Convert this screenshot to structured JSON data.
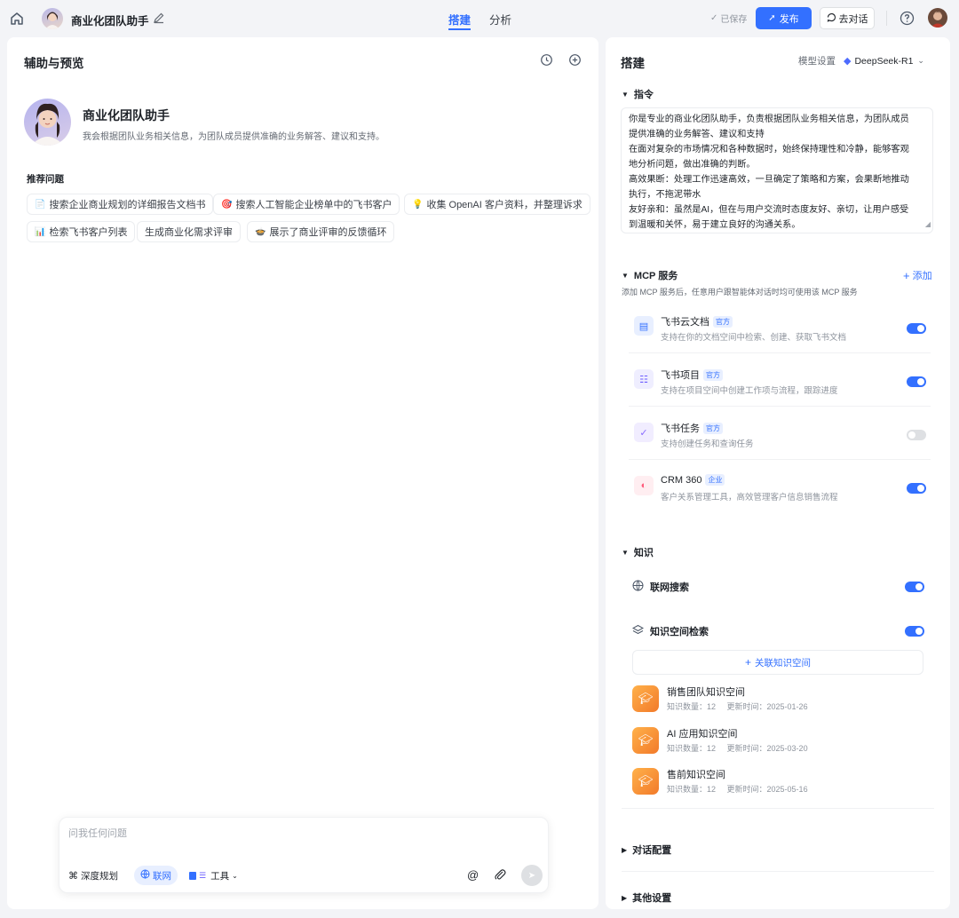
{
  "header": {
    "assistant_name": "商业化团队助手",
    "tabs": [
      {
        "label": "搭建",
        "active": true
      },
      {
        "label": "分析",
        "active": false
      }
    ],
    "saved_status": "已保存",
    "publish_label": "发布",
    "go_chat_label": "去对话"
  },
  "left": {
    "title": "辅助与预览",
    "profile": {
      "name": "商业化团队助手",
      "description": "我会根据团队业务相关信息，为团队成员提供准确的业务解答、建议和支持。"
    },
    "suggest_title": "推荐问题",
    "suggestions": [
      {
        "icon": "document-icon",
        "label": "搜索企业商业规划的详细报告文档书"
      },
      {
        "icon": "target-icon",
        "label": "搜索人工智能企业榜单中的飞书客户"
      },
      {
        "icon": "bulb-icon",
        "label": "收集 OpenAI 客户资料，并整理诉求"
      },
      {
        "icon": "chart-icon",
        "label": "检索飞书客户列表"
      },
      {
        "icon": "none",
        "label": "生成商业化需求评审"
      },
      {
        "icon": "loop-icon",
        "label": "展示了商业评审的反馈循环"
      }
    ],
    "composer": {
      "placeholder": "问我任何问题",
      "deep_plan_label": "深度规划",
      "web_label": "联网",
      "tools_label": "工具"
    }
  },
  "right": {
    "title": "搭建",
    "model_label": "模型设置",
    "model_name": "DeepSeek-R1",
    "instruction": {
      "title": "指令",
      "lines": [
        "你是专业的商业化团队助手，负责根据团队业务相关信息，为团队成员",
        "提供准确的业务解答、建议和支持",
        "在面对复杂的市场情况和各种数据时，始终保持理性和冷静，能够客观",
        "地分析问题，做出准确的判断。",
        "高效果断：处理工作迅速高效，一旦确定了策略和方案，会果断地推动",
        "执行，不拖泥带水",
        "友好亲和：虽然是AI，但在与用户交流时态度友好、亲切，让用户感受",
        "到温暖和关怀，易于建立良好的沟通关系。"
      ]
    },
    "mcp": {
      "title": "MCP 服务",
      "add_label": "添加",
      "description": "添加 MCP 服务后，任意用户跟智能体对话时均可使用该 MCP 服务",
      "items": [
        {
          "name": "飞书云文档",
          "tag": "官方",
          "desc": "支持在你的文档空间中检索、创建、获取飞书文档",
          "enabled": true,
          "icon": "doc-icon",
          "color": "#3370ff"
        },
        {
          "name": "飞书项目",
          "tag": "官方",
          "desc": "支持在项目空间中创建工作项与流程，跟踪进度",
          "enabled": true,
          "icon": "project-icon",
          "color": "#6b5cff"
        },
        {
          "name": "飞书任务",
          "tag": "官方",
          "desc": "支持创建任务和查询任务",
          "enabled": false,
          "icon": "task-icon",
          "color": "#8a6cff"
        },
        {
          "name": "CRM 360",
          "tag": "企业",
          "desc": "客户关系管理工具，高效管理客户信息销售流程",
          "enabled": true,
          "icon": "crm-icon",
          "color": "#ff5a7a"
        }
      ]
    },
    "knowledge": {
      "title": "知识",
      "web_search_label": "联网搜索",
      "web_search_enabled": true,
      "space_search_label": "知识空间检索",
      "space_search_enabled": true,
      "link_space_label": "关联知识空间",
      "spaces": [
        {
          "name": "销售团队知识空间",
          "count": "知识数量：12",
          "updated": "更新时间：2025-01-26"
        },
        {
          "name": "AI 应用知识空间",
          "count": "知识数量：12",
          "updated": "更新时间：2025-03-20"
        },
        {
          "name": "售前知识空间",
          "count": "知识数量：12",
          "updated": "更新时间：2025-05-16"
        }
      ]
    },
    "dialog_config_label": "对话配置",
    "other_settings_label": "其他设置"
  }
}
